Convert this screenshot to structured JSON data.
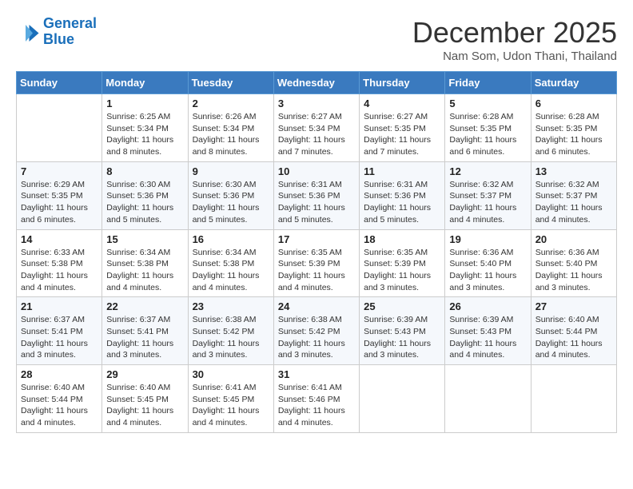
{
  "header": {
    "logo_line1": "General",
    "logo_line2": "Blue",
    "title": "December 2025",
    "subtitle": "Nam Som, Udon Thani, Thailand"
  },
  "weekdays": [
    "Sunday",
    "Monday",
    "Tuesday",
    "Wednesday",
    "Thursday",
    "Friday",
    "Saturday"
  ],
  "weeks": [
    [
      {
        "day": "",
        "sunrise": "",
        "sunset": "",
        "daylight": ""
      },
      {
        "day": "1",
        "sunrise": "Sunrise: 6:25 AM",
        "sunset": "Sunset: 5:34 PM",
        "daylight": "Daylight: 11 hours and 8 minutes."
      },
      {
        "day": "2",
        "sunrise": "Sunrise: 6:26 AM",
        "sunset": "Sunset: 5:34 PM",
        "daylight": "Daylight: 11 hours and 8 minutes."
      },
      {
        "day": "3",
        "sunrise": "Sunrise: 6:27 AM",
        "sunset": "Sunset: 5:34 PM",
        "daylight": "Daylight: 11 hours and 7 minutes."
      },
      {
        "day": "4",
        "sunrise": "Sunrise: 6:27 AM",
        "sunset": "Sunset: 5:35 PM",
        "daylight": "Daylight: 11 hours and 7 minutes."
      },
      {
        "day": "5",
        "sunrise": "Sunrise: 6:28 AM",
        "sunset": "Sunset: 5:35 PM",
        "daylight": "Daylight: 11 hours and 6 minutes."
      },
      {
        "day": "6",
        "sunrise": "Sunrise: 6:28 AM",
        "sunset": "Sunset: 5:35 PM",
        "daylight": "Daylight: 11 hours and 6 minutes."
      }
    ],
    [
      {
        "day": "7",
        "sunrise": "Sunrise: 6:29 AM",
        "sunset": "Sunset: 5:35 PM",
        "daylight": "Daylight: 11 hours and 6 minutes."
      },
      {
        "day": "8",
        "sunrise": "Sunrise: 6:30 AM",
        "sunset": "Sunset: 5:36 PM",
        "daylight": "Daylight: 11 hours and 5 minutes."
      },
      {
        "day": "9",
        "sunrise": "Sunrise: 6:30 AM",
        "sunset": "Sunset: 5:36 PM",
        "daylight": "Daylight: 11 hours and 5 minutes."
      },
      {
        "day": "10",
        "sunrise": "Sunrise: 6:31 AM",
        "sunset": "Sunset: 5:36 PM",
        "daylight": "Daylight: 11 hours and 5 minutes."
      },
      {
        "day": "11",
        "sunrise": "Sunrise: 6:31 AM",
        "sunset": "Sunset: 5:36 PM",
        "daylight": "Daylight: 11 hours and 5 minutes."
      },
      {
        "day": "12",
        "sunrise": "Sunrise: 6:32 AM",
        "sunset": "Sunset: 5:37 PM",
        "daylight": "Daylight: 11 hours and 4 minutes."
      },
      {
        "day": "13",
        "sunrise": "Sunrise: 6:32 AM",
        "sunset": "Sunset: 5:37 PM",
        "daylight": "Daylight: 11 hours and 4 minutes."
      }
    ],
    [
      {
        "day": "14",
        "sunrise": "Sunrise: 6:33 AM",
        "sunset": "Sunset: 5:38 PM",
        "daylight": "Daylight: 11 hours and 4 minutes."
      },
      {
        "day": "15",
        "sunrise": "Sunrise: 6:34 AM",
        "sunset": "Sunset: 5:38 PM",
        "daylight": "Daylight: 11 hours and 4 minutes."
      },
      {
        "day": "16",
        "sunrise": "Sunrise: 6:34 AM",
        "sunset": "Sunset: 5:38 PM",
        "daylight": "Daylight: 11 hours and 4 minutes."
      },
      {
        "day": "17",
        "sunrise": "Sunrise: 6:35 AM",
        "sunset": "Sunset: 5:39 PM",
        "daylight": "Daylight: 11 hours and 4 minutes."
      },
      {
        "day": "18",
        "sunrise": "Sunrise: 6:35 AM",
        "sunset": "Sunset: 5:39 PM",
        "daylight": "Daylight: 11 hours and 3 minutes."
      },
      {
        "day": "19",
        "sunrise": "Sunrise: 6:36 AM",
        "sunset": "Sunset: 5:40 PM",
        "daylight": "Daylight: 11 hours and 3 minutes."
      },
      {
        "day": "20",
        "sunrise": "Sunrise: 6:36 AM",
        "sunset": "Sunset: 5:40 PM",
        "daylight": "Daylight: 11 hours and 3 minutes."
      }
    ],
    [
      {
        "day": "21",
        "sunrise": "Sunrise: 6:37 AM",
        "sunset": "Sunset: 5:41 PM",
        "daylight": "Daylight: 11 hours and 3 minutes."
      },
      {
        "day": "22",
        "sunrise": "Sunrise: 6:37 AM",
        "sunset": "Sunset: 5:41 PM",
        "daylight": "Daylight: 11 hours and 3 minutes."
      },
      {
        "day": "23",
        "sunrise": "Sunrise: 6:38 AM",
        "sunset": "Sunset: 5:42 PM",
        "daylight": "Daylight: 11 hours and 3 minutes."
      },
      {
        "day": "24",
        "sunrise": "Sunrise: 6:38 AM",
        "sunset": "Sunset: 5:42 PM",
        "daylight": "Daylight: 11 hours and 3 minutes."
      },
      {
        "day": "25",
        "sunrise": "Sunrise: 6:39 AM",
        "sunset": "Sunset: 5:43 PM",
        "daylight": "Daylight: 11 hours and 3 minutes."
      },
      {
        "day": "26",
        "sunrise": "Sunrise: 6:39 AM",
        "sunset": "Sunset: 5:43 PM",
        "daylight": "Daylight: 11 hours and 4 minutes."
      },
      {
        "day": "27",
        "sunrise": "Sunrise: 6:40 AM",
        "sunset": "Sunset: 5:44 PM",
        "daylight": "Daylight: 11 hours and 4 minutes."
      }
    ],
    [
      {
        "day": "28",
        "sunrise": "Sunrise: 6:40 AM",
        "sunset": "Sunset: 5:44 PM",
        "daylight": "Daylight: 11 hours and 4 minutes."
      },
      {
        "day": "29",
        "sunrise": "Sunrise: 6:40 AM",
        "sunset": "Sunset: 5:45 PM",
        "daylight": "Daylight: 11 hours and 4 minutes."
      },
      {
        "day": "30",
        "sunrise": "Sunrise: 6:41 AM",
        "sunset": "Sunset: 5:45 PM",
        "daylight": "Daylight: 11 hours and 4 minutes."
      },
      {
        "day": "31",
        "sunrise": "Sunrise: 6:41 AM",
        "sunset": "Sunset: 5:46 PM",
        "daylight": "Daylight: 11 hours and 4 minutes."
      },
      {
        "day": "",
        "sunrise": "",
        "sunset": "",
        "daylight": ""
      },
      {
        "day": "",
        "sunrise": "",
        "sunset": "",
        "daylight": ""
      },
      {
        "day": "",
        "sunrise": "",
        "sunset": "",
        "daylight": ""
      }
    ]
  ]
}
